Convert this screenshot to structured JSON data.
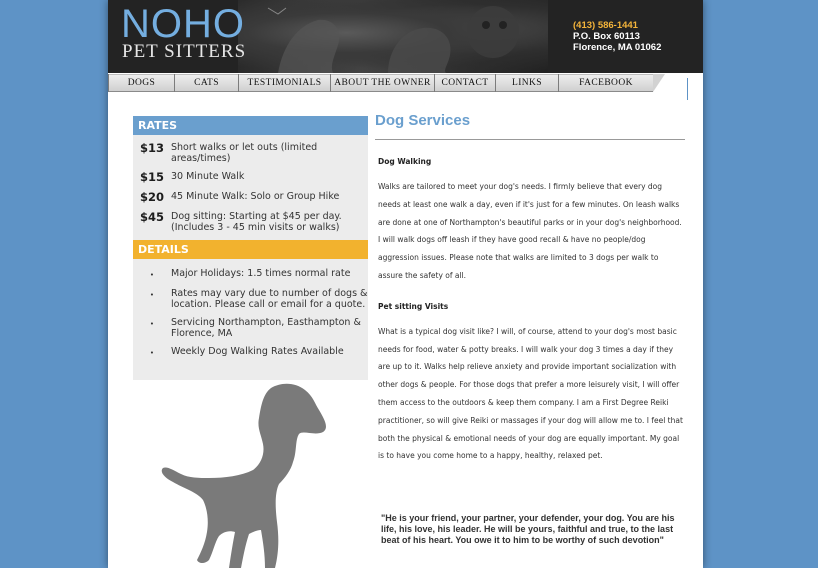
{
  "header": {
    "logo_main": "NOHO",
    "logo_sub": "PET SITTERS",
    "phone": "(413) 586-1441",
    "address_line1": "P.O. Box 60113",
    "address_line2": "Florence, MA 01062"
  },
  "nav": {
    "items": [
      {
        "label": "DOGS"
      },
      {
        "label": "CATS"
      },
      {
        "label": "TESTIMONIALS"
      },
      {
        "label": "ABOUT THE OWNER"
      },
      {
        "label": "CONTACT"
      },
      {
        "label": "LINKS"
      },
      {
        "label": "FACEBOOK"
      }
    ]
  },
  "sidebar": {
    "rates_title": "RATES",
    "rates": [
      {
        "price": "$13",
        "text": "Short walks or let outs (limited areas/times)"
      },
      {
        "price": "$15",
        "text": "30 Minute Walk"
      },
      {
        "price": "$20",
        "text": "45 Minute Walk: Solo or Group Hike"
      },
      {
        "price": "$45",
        "text": "Dog sitting: Starting at $45 per day. (Includes 3 - 45 min visits or walks)"
      }
    ],
    "details_title": "DETAILS",
    "details": [
      {
        "bullet": "•",
        "text": "Major Holidays: 1.5 times normal rate"
      },
      {
        "bullet": "•",
        "text": "Rates may vary due to number of dogs & location. Please call or email for a quote."
      },
      {
        "bullet": "•",
        "text": "Servicing Northampton, Easthampton & Florence, MA"
      },
      {
        "bullet": "•",
        "text": "Weekly Dog Walking Rates Available"
      }
    ]
  },
  "content": {
    "title": "Dog Services",
    "walking_title": "Dog Walking",
    "walking_text": "Walks are tailored to meet your dog's needs. I firmly believe that every dog needs at least one walk a day, even if it's just for a few minutes. On leash walks are done at one of Northampton's beautiful parks or in your dog's neighborhood. I will walk dogs off leash if they have good recall & have no people/dog aggression issues. Please note that walks are limited to 3 dogs per walk to assure the safety of all.",
    "sitting_title": "Pet sitting Visits",
    "sitting_text": "What is a typical dog visit like? I will, of course, attend to your dog's most basic needs for food, water & potty breaks. I will walk your dog 3 times a day if they are up to it. Walks help relieve anxiety and provide important socialization with other dogs & people. For those dogs that prefer a more leisurely visit, I will offer them access to the outdoors & keep them company. I am a First Degree Reiki practitioner, so will give Reiki or massages if your dog will allow me to. I feel that both the physical & emotional needs of your dog are equally important. My goal is to have you come home to a happy, healthy, relaxed pet.",
    "quote": "\"He is your friend, your partner, your defender, your dog. You are his life, his love, his leader. He will be yours, faithful and true, to the last beat of his heart. You owe it to him to be worthy of such devotion\""
  },
  "colors": {
    "background": "#5e93c6",
    "accent_blue": "#6a9fce",
    "accent_orange": "#f2b22e",
    "phone": "#f4b43a"
  }
}
